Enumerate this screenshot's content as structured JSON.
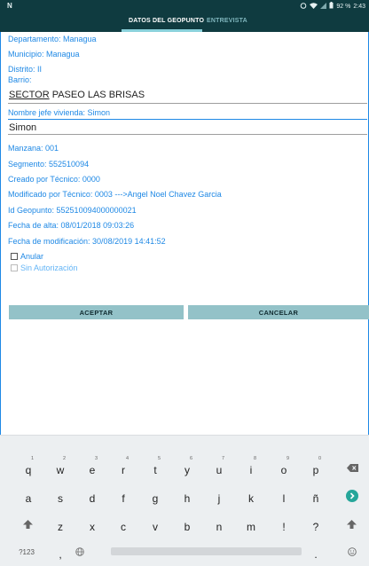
{
  "status_bar": {
    "left_icon": "N",
    "battery_percent": "92 %",
    "time": "2:43"
  },
  "tabs": {
    "active": "DATOS DEL GEOPUNTO",
    "inactive": "ENTREVISTA"
  },
  "form": {
    "departamento": "Departamento: Managua",
    "municipio": "Municipio: Managua",
    "distrito": "Distrito: II",
    "barrio": "Barrio:",
    "sector_word": "SECTOR",
    "sector_rest": " PASEO LAS BRISAS",
    "nombre_jefe": "Nombre jefe vivienda: Simon",
    "nombre_value": "Simon",
    "manzana": "Manzana: 001",
    "segmento": "Segmento: 552510094",
    "creado": "Creado por Técnico: 0000",
    "modificado": "Modificado por Técnico: 0003 --->Angel Noel Chavez Garcia",
    "id_geopunto": "Id Geopunto: 552510094000000021",
    "fecha_alta": "Fecha de alta: 08/01/2018 09:03:26",
    "fecha_mod": "Fecha de modificación: 30/08/2019 14:41:52",
    "anular": "Anular",
    "sin_autorizacion": "Sin Autorización"
  },
  "buttons": {
    "aceptar": "ACEPTAR",
    "cancelar": "CANCELAR"
  },
  "keyboard": {
    "row1": [
      "q",
      "w",
      "e",
      "r",
      "t",
      "y",
      "u",
      "i",
      "o",
      "p"
    ],
    "row1_sup": [
      "1",
      "2",
      "3",
      "4",
      "5",
      "6",
      "7",
      "8",
      "9",
      "0"
    ],
    "row2": [
      "a",
      "s",
      "d",
      "f",
      "g",
      "h",
      "j",
      "k",
      "l",
      "ñ"
    ],
    "row3": [
      "z",
      "x",
      "c",
      "v",
      "b",
      "n",
      "m",
      "!",
      "?"
    ],
    "sym_key": "?123",
    "comma": ",",
    "period": "."
  },
  "colors": {
    "accent_label": "#1e88e5",
    "app_bar": "#0f3b40",
    "button": "#93c2c8",
    "enter_key": "#26a69a"
  },
  "icons": {
    "wifi": "wifi-icon",
    "battery": "battery-icon",
    "backspace": "backspace-icon",
    "enter": "enter-icon",
    "shift": "shift-icon",
    "globe": "globe-icon",
    "emoji": "emoji-icon"
  }
}
